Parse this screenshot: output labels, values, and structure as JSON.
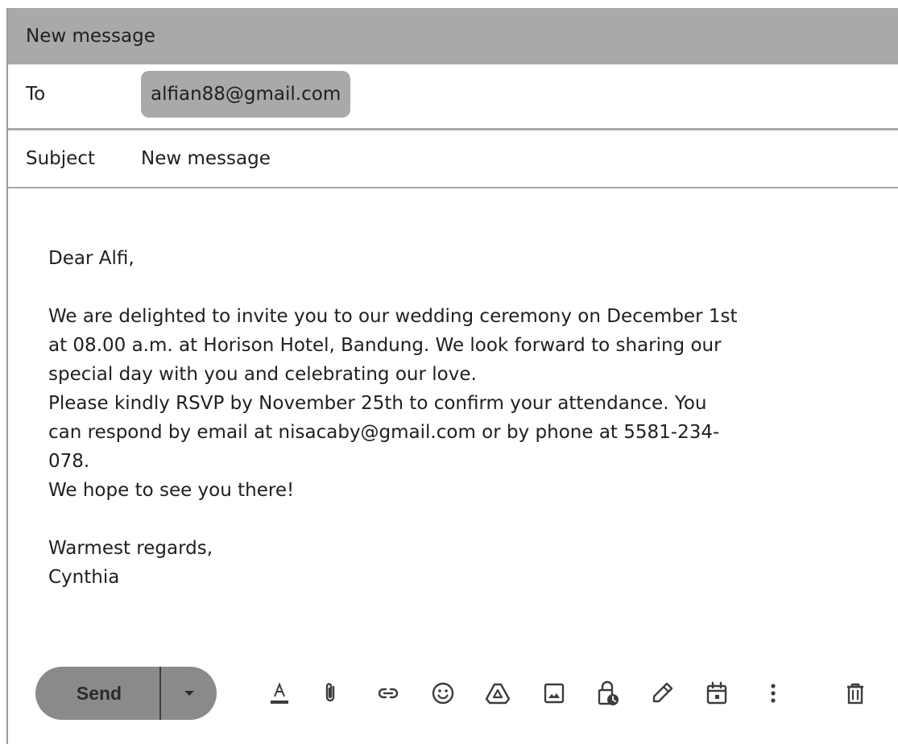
{
  "window": {
    "title": "New message"
  },
  "to": {
    "label": "To",
    "recipient": "alfian88@gmail.com"
  },
  "subject": {
    "label": "Subject",
    "value": "New message"
  },
  "body": {
    "greeting": "Dear Alfi,",
    "lines": [
      "We are delighted to invite you to our wedding ceremony on December 1st",
      "at 08.00 a.m. at Horison Hotel, Bandung. We look forward to sharing our",
      "special day with you and celebrating our love.",
      "Please kindly RSVP by November 25th to confirm your attendance. You",
      "can respond by email at nisacaby@gmail.com or by phone at 5581-234-",
      "078.",
      "We hope to see you there!"
    ],
    "closing": "Warmest regards,",
    "signature": "Cynthia"
  },
  "toolbar": {
    "send_label": "Send",
    "icons": [
      "text-format-icon",
      "attach-icon",
      "link-icon",
      "emoji-icon",
      "drive-icon",
      "image-icon",
      "confidential-icon",
      "signature-icon",
      "schedule-icon",
      "more-options-icon",
      "delete-icon"
    ]
  },
  "colors": {
    "header_gray": "#a9a9a9",
    "send_button": "#8a8a8a",
    "text": "#1f1f1f",
    "icon": "#3c3c3c"
  }
}
